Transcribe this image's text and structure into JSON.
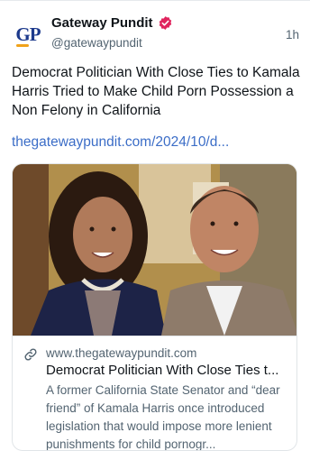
{
  "author": {
    "display_name": "Gateway Pundit",
    "handle": "@gatewaypundit",
    "avatar_letters": "GP",
    "verified_color": "#e0245e"
  },
  "post": {
    "timestamp": "1h",
    "text": "Democrat Politician With Close Ties to Kamala Harris Tried to Make Child Porn Possession a Non Felony in California",
    "link_text": "thegatewaypundit.com/2024/10/d..."
  },
  "card": {
    "domain": "www.thegatewaypundit.com",
    "title": "Democrat Politician With Close Ties t...",
    "description": "A former California State Senator and “dear friend” of Kamala Harris once introduced legislation that would impose more lenient punishments for child pornogr..."
  },
  "colors": {
    "link": "#3b6dc7",
    "secondary_text": "#536471",
    "primary_text": "#0f1419"
  }
}
